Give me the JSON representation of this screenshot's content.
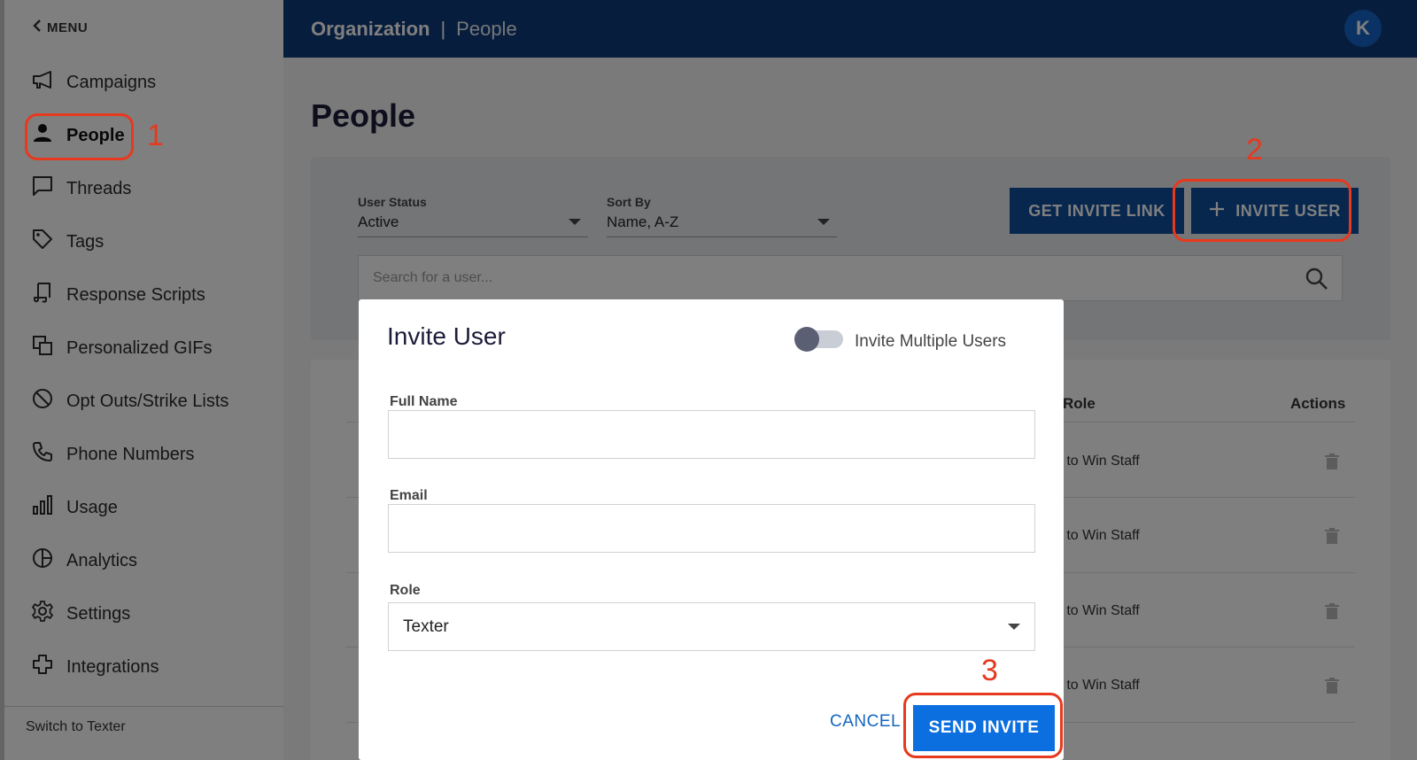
{
  "sidebar": {
    "menu_label": "MENU",
    "items": [
      {
        "label": "Campaigns",
        "icon": "megaphone-icon"
      },
      {
        "label": "People",
        "icon": "person-icon"
      },
      {
        "label": "Threads",
        "icon": "chat-bubble-icon"
      },
      {
        "label": "Tags",
        "icon": "tag-icon"
      },
      {
        "label": "Response Scripts",
        "icon": "script-icon"
      },
      {
        "label": "Personalized GIFs",
        "icon": "stacked-images-icon"
      },
      {
        "label": "Opt Outs/Strike Lists",
        "icon": "prohibited-icon"
      },
      {
        "label": "Phone Numbers",
        "icon": "phone-icon"
      },
      {
        "label": "Usage",
        "icon": "bar-chart-icon"
      },
      {
        "label": "Analytics",
        "icon": "pie-chart-icon"
      },
      {
        "label": "Settings",
        "icon": "gear-icon"
      },
      {
        "label": "Integrations",
        "icon": "puzzle-icon"
      }
    ],
    "active": "People",
    "switch_label": "Switch to Texter"
  },
  "header": {
    "org": "Organization",
    "separator": "|",
    "page": "People",
    "avatar_initial": "K"
  },
  "main": {
    "title": "People",
    "filters": {
      "user_status_label": "User Status",
      "user_status_value": "Active",
      "sort_by_label": "Sort By",
      "sort_by_value": "Name, A-Z"
    },
    "get_invite_link_label": "GET INVITE LINK",
    "invite_user_label": "INVITE USER",
    "search_placeholder": "Search for a user...",
    "table": {
      "headers": {
        "role": "Role",
        "actions": "Actions"
      },
      "rows": [
        {
          "role": "e to Win Staff"
        },
        {
          "role": "e to Win Staff"
        },
        {
          "role": "e to Win Staff"
        },
        {
          "role": "e to Win Staff"
        }
      ]
    }
  },
  "modal": {
    "title": "Invite User",
    "multi_toggle_label": "Invite Multiple Users",
    "full_name_label": "Full Name",
    "full_name_value": "",
    "email_label": "Email",
    "email_value": "",
    "role_label": "Role",
    "role_value": "Texter",
    "cancel_label": "CANCEL",
    "send_label": "SEND INVITE"
  },
  "annotations": {
    "step1": "1",
    "step2": "2",
    "step3": "3",
    "color": "#e6391e"
  },
  "colors": {
    "topbar": "#0e3a7a",
    "primary_button": "#0e4f9e",
    "send_button": "#0c6fe0"
  }
}
